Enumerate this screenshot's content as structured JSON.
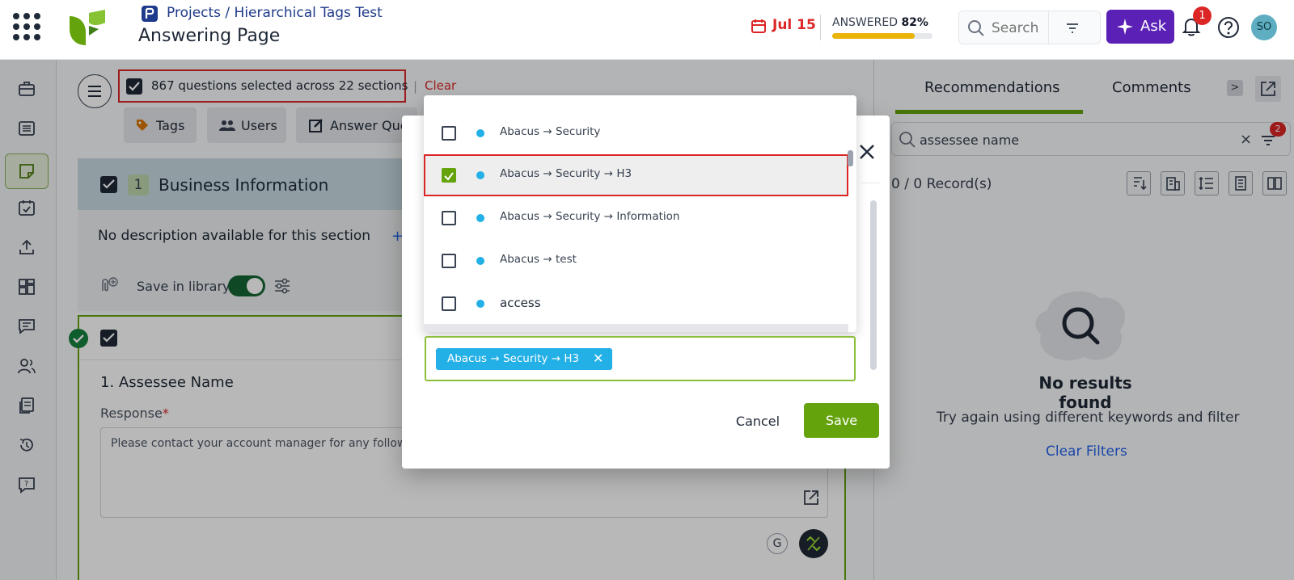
{
  "header": {
    "breadcrumb": "Projects / Hierarchical Tags Test",
    "title": "Answering Page",
    "due_date": "Jul 15",
    "answered_label": "ANSWERED",
    "answered_pct": "82%",
    "answered_fraction": 0.82,
    "search_placeholder": "Search",
    "ask_label": "Ask",
    "notification_count": "1",
    "avatar_initials": "SO"
  },
  "selection": {
    "text": "867 questions selected across 22 sections",
    "separator": "|",
    "clear": "Clear"
  },
  "toolbar": {
    "tags": "Tags",
    "users": "Users",
    "answer": "Answer Que"
  },
  "section": {
    "number": "1",
    "title": "Business Information",
    "description": "No description available for this section",
    "plus": "+",
    "save_in_library": "Save in library"
  },
  "question": {
    "title": "1. Assessee Name",
    "response_label": "Response",
    "required_mark": "*",
    "response_text": "Please contact your account manager for any follow-u",
    "g_label": "G"
  },
  "right_panel": {
    "tabs": [
      "Recommendations",
      "Comments"
    ],
    "more": ">",
    "search_value": "assessee name",
    "clear": "×",
    "filter_badge": "2",
    "records": "0 / 0  Record(s)",
    "no_results": "No results found",
    "try_again": "Try again using different keywords and filter",
    "clear_filters": "Clear Filters"
  },
  "modal": {
    "options": [
      {
        "parts": [
          "Abacus",
          "Security"
        ],
        "checked": false
      },
      {
        "parts": [
          "Abacus",
          "Security",
          "H3"
        ],
        "checked": true
      },
      {
        "parts": [
          "Abacus",
          "Security",
          "Information"
        ],
        "checked": false
      },
      {
        "parts": [
          "Abacus",
          "test"
        ],
        "checked": false
      },
      {
        "parts": [
          "access"
        ],
        "checked": false
      }
    ],
    "selected_tag": "Abacus → Security → H3",
    "selected_tag_remove": "✕",
    "cancel": "Cancel",
    "save": "Save",
    "close": "×"
  },
  "colors": {
    "accent_green": "#65a30d",
    "tag_blue": "#22b0e6",
    "highlight_red": "#dc2626",
    "ask_purple": "#5b21b6"
  }
}
